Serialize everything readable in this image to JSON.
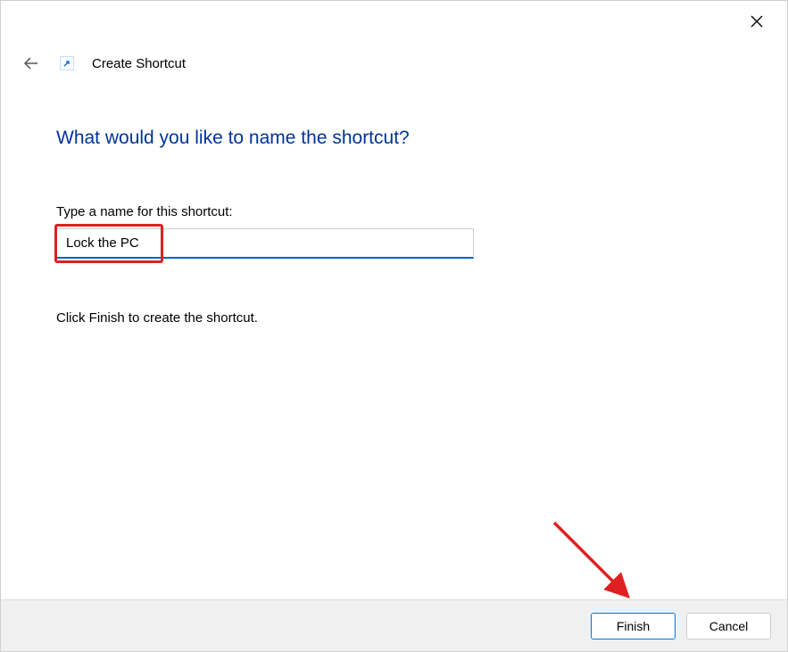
{
  "window": {
    "wizard_title": "Create Shortcut"
  },
  "content": {
    "question": "What would you like to name the shortcut?",
    "prompt_label": "Type a name for this shortcut:",
    "input_value": "Lock the PC",
    "instruction": "Click Finish to create the shortcut."
  },
  "footer": {
    "finish_label": "Finish",
    "cancel_label": "Cancel"
  }
}
